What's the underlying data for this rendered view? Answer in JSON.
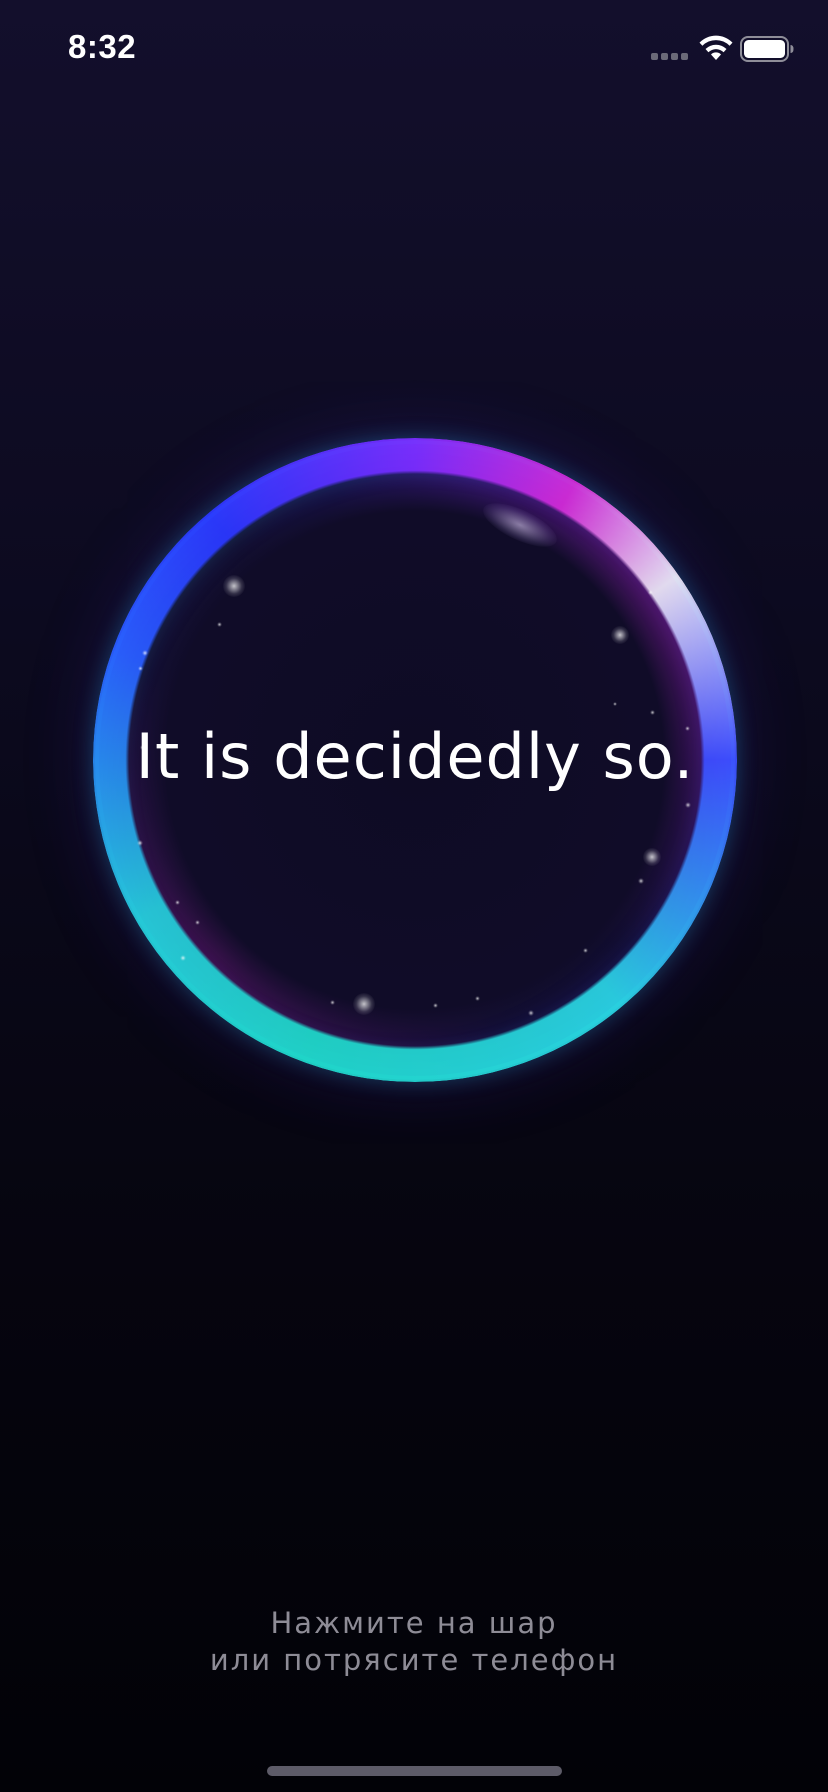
{
  "status_bar": {
    "time": "8:32",
    "icons": [
      "signal-icon",
      "wifi-icon",
      "battery-icon"
    ]
  },
  "ball": {
    "answer": "It is decidedly so."
  },
  "hint": {
    "line1": "Нажмите на шар",
    "line2": "или потрясите телефон"
  },
  "colors": {
    "background_top": "#130f2c",
    "background_bottom": "#020207",
    "rim_teal": "#1fd6c8",
    "rim_blue": "#2a5cff",
    "rim_magenta": "#d12ad6",
    "hint_text": "#8e8c96"
  }
}
